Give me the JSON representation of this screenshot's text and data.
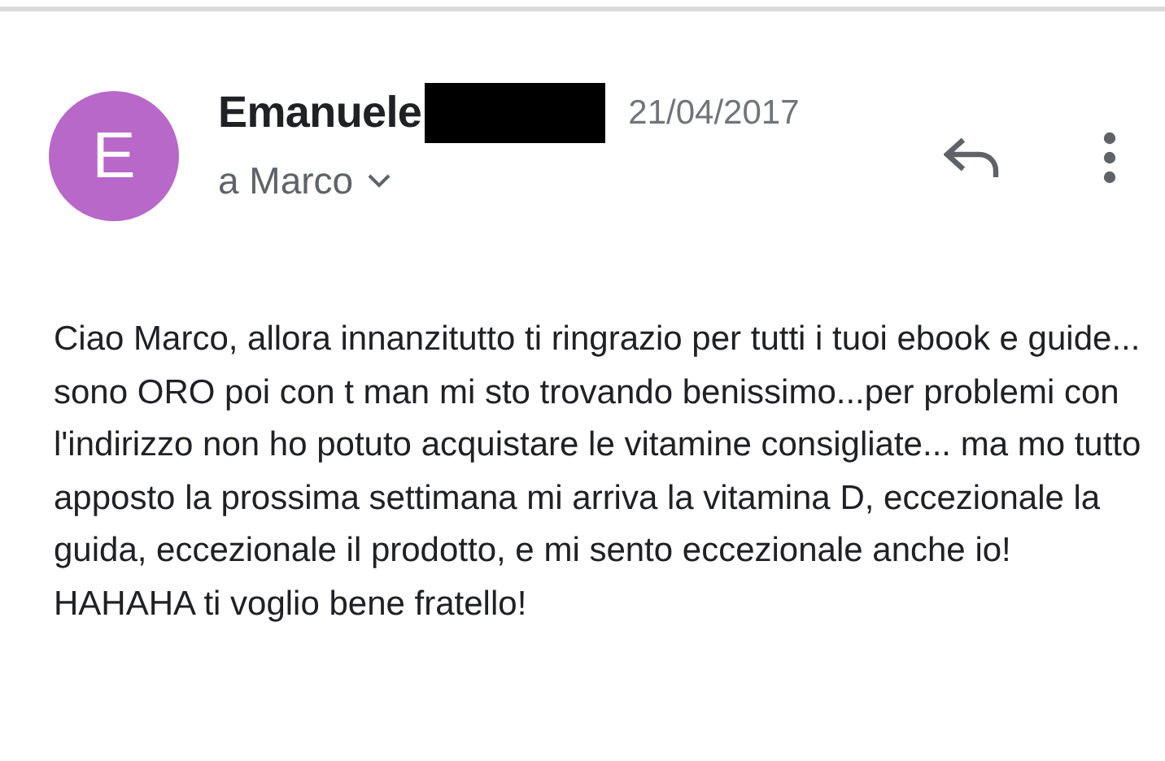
{
  "sender": {
    "avatar_letter": "E",
    "name": "Emanuele",
    "date": "21/04/2017",
    "recipient": "a Marco"
  },
  "body": "Ciao Marco, allora innanzitutto ti ringrazio per tutti i tuoi ebook e guide... sono ORO poi con t man mi sto trovando benissimo...per problemi con l'indirizzo non ho potuto acquistare le vitamine consigliate... ma mo tutto apposto la prossima settimana mi arriva la vitamina D, eccezionale la guida, eccezionale il prodotto, e mi sento eccezionale anche io! HAHAHA ti voglio bene fratello!"
}
